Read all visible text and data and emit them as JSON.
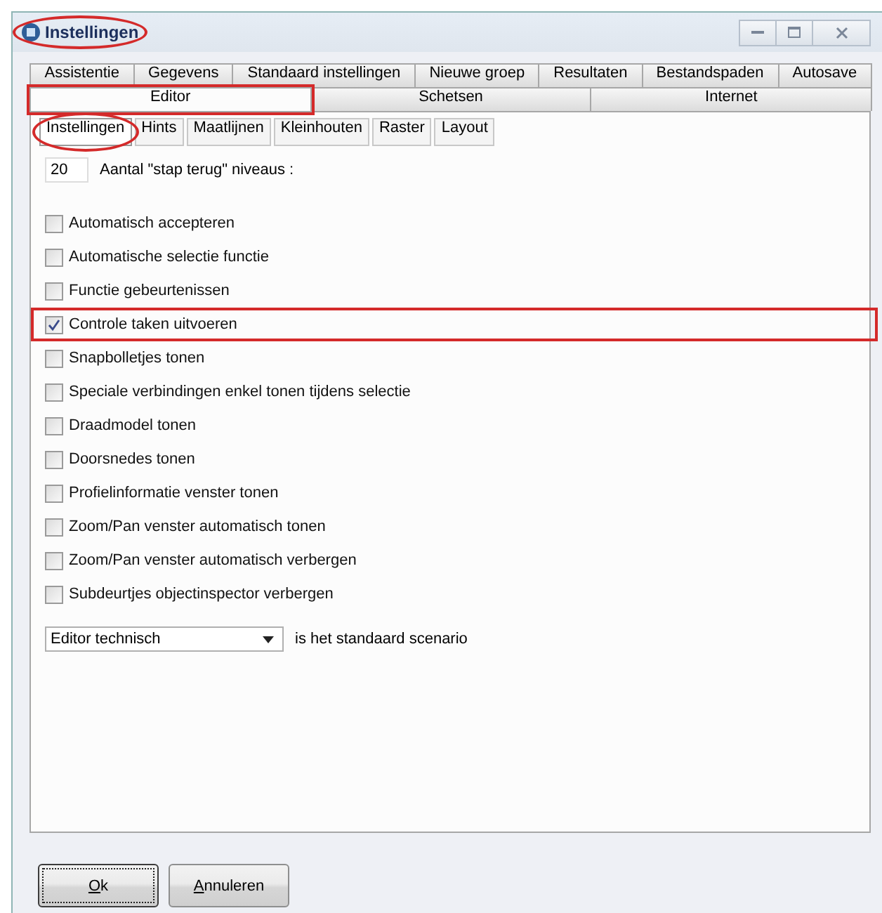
{
  "window": {
    "title": "Instellingen",
    "circled": true
  },
  "tab_rows": [
    [
      {
        "label": "Assistentie",
        "selected": false
      },
      {
        "label": "Gegevens",
        "selected": false
      },
      {
        "label": "Standaard instellingen",
        "selected": false
      },
      {
        "label": "Nieuwe groep",
        "selected": false
      },
      {
        "label": "Resultaten",
        "selected": false
      },
      {
        "label": "Bestandspaden",
        "selected": false
      },
      {
        "label": "Autosave",
        "selected": false
      }
    ],
    [
      {
        "label": "Editor",
        "selected": true,
        "boxed": true
      },
      {
        "label": "Schetsen",
        "selected": false
      },
      {
        "label": "Internet",
        "selected": false
      }
    ]
  ],
  "subtabs": [
    {
      "label": "Instellingen",
      "selected": true,
      "circled": true
    },
    {
      "label": "Hints",
      "selected": false
    },
    {
      "label": "Maatlijnen",
      "selected": false
    },
    {
      "label": "Kleinhouten",
      "selected": false
    },
    {
      "label": "Raster",
      "selected": false
    },
    {
      "label": "Layout",
      "selected": false
    }
  ],
  "undo_levels": {
    "value": "20",
    "label": "Aantal \"stap terug\" niveaus :"
  },
  "options": [
    {
      "label": "Automatisch accepteren",
      "checked": false
    },
    {
      "label": "Automatische selectie functie",
      "checked": false
    },
    {
      "label": "Functie gebeurtenissen",
      "checked": false
    },
    {
      "label": "Controle taken uitvoeren",
      "checked": true,
      "boxed": true
    },
    {
      "label": "Snapbolletjes tonen",
      "checked": false
    },
    {
      "label": "Speciale verbindingen enkel tonen tijdens selectie",
      "checked": false
    },
    {
      "label": "Draadmodel tonen",
      "checked": false
    },
    {
      "label": "Doorsnedes tonen",
      "checked": false
    },
    {
      "label": "Profielinformatie venster tonen",
      "checked": false
    },
    {
      "label": "Zoom/Pan venster automatisch tonen",
      "checked": false
    },
    {
      "label": "Zoom/Pan venster automatisch verbergen",
      "checked": false
    },
    {
      "label": "Subdeurtjes objectinspector verbergen",
      "checked": false
    }
  ],
  "scenario": {
    "value": "Editor technisch",
    "label": "is het standaard scenario"
  },
  "buttons": [
    {
      "label": "Ok",
      "default": true,
      "mnemonic_underlined": true
    },
    {
      "label": "Annuleren",
      "default": false,
      "mnemonic_underlined": true
    }
  ]
}
